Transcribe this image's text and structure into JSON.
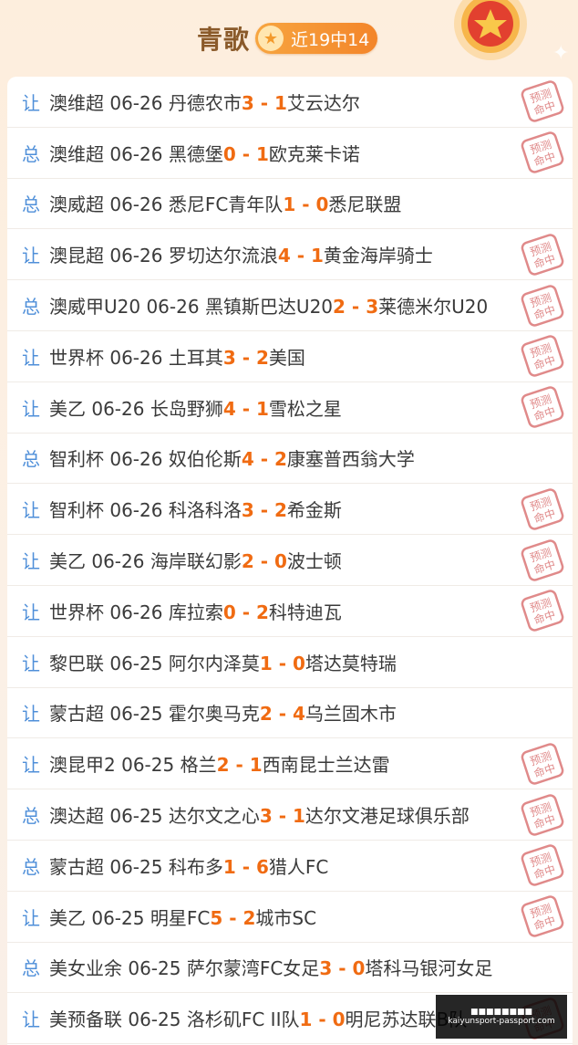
{
  "header": {
    "title": "青歌",
    "record_badge": "近19中14"
  },
  "colors": {
    "accent": "#f06b12",
    "tag_blue": "#4f8fd9",
    "badge_orange": "#f3852a",
    "stamp_red": "#e08a8a"
  },
  "stamp_text": {
    "line1": "预测",
    "line2": "命中"
  },
  "rows": [
    {
      "tag": "让",
      "league": "澳维超",
      "date": "06-26",
      "home": "丹德农市",
      "score_home": "3",
      "sep": " - ",
      "score_away": "1",
      "away": "艾云达尔",
      "hit": true
    },
    {
      "tag": "总",
      "league": "澳维超",
      "date": "06-26",
      "home": "黑德堡",
      "score_home": "0",
      "sep": " - ",
      "score_away": "1",
      "away": "欧克莱卡诺",
      "hit": true
    },
    {
      "tag": "总",
      "league": "澳威超",
      "date": "06-26",
      "home": "悉尼FC青年队",
      "score_home": "1",
      "sep": " - ",
      "score_away": "0",
      "away": "悉尼联盟",
      "hit": false
    },
    {
      "tag": "让",
      "league": "澳昆超",
      "date": "06-26",
      "home": "罗切达尔流浪",
      "score_home": "4",
      "sep": " - ",
      "score_away": "1",
      "away": "黄金海岸骑士",
      "hit": true
    },
    {
      "tag": "总",
      "league": "澳威甲U20",
      "date": "06-26",
      "home": "黑镇斯巴达U20",
      "score_home": "2",
      "sep": " - ",
      "score_away": "3",
      "away": "莱德米尔U20",
      "hit": true
    },
    {
      "tag": "让",
      "league": "世界杯",
      "date": "06-26",
      "home": "土耳其",
      "score_home": "3",
      "sep": " - ",
      "score_away": "2",
      "away": "美国",
      "hit": true
    },
    {
      "tag": "让",
      "league": "美乙",
      "date": "06-26",
      "home": "长岛野狮",
      "score_home": "4",
      "sep": " - ",
      "score_away": "1",
      "away": "雪松之星",
      "hit": true
    },
    {
      "tag": "总",
      "league": "智利杯",
      "date": "06-26",
      "home": "奴伯伦斯",
      "score_home": "4",
      "sep": " - ",
      "score_away": "2",
      "away": "康塞普西翁大学",
      "hit": false
    },
    {
      "tag": "让",
      "league": "智利杯",
      "date": "06-26",
      "home": "科洛科洛",
      "score_home": "3",
      "sep": " - ",
      "score_away": "2",
      "away": "希金斯",
      "hit": true
    },
    {
      "tag": "让",
      "league": "美乙",
      "date": "06-26",
      "home": "海岸联幻影",
      "score_home": "2",
      "sep": " - ",
      "score_away": "0",
      "away": "波士顿",
      "hit": true
    },
    {
      "tag": "让",
      "league": "世界杯",
      "date": "06-26",
      "home": "库拉索",
      "score_home": "0",
      "sep": " - ",
      "score_away": "2",
      "away": "科特迪瓦",
      "hit": true
    },
    {
      "tag": "让",
      "league": "黎巴联",
      "date": "06-25",
      "home": "阿尔内泽莫",
      "score_home": "1",
      "sep": " - ",
      "score_away": "0",
      "away": "塔达莫特瑞",
      "hit": false
    },
    {
      "tag": "让",
      "league": "蒙古超",
      "date": "06-25",
      "home": "霍尔奥马克",
      "score_home": "2",
      "sep": " - ",
      "score_away": "4",
      "away": "乌兰固木市",
      "hit": false
    },
    {
      "tag": "让",
      "league": "澳昆甲2",
      "date": "06-25",
      "home": "格兰",
      "score_home": "2",
      "sep": " - ",
      "score_away": "1",
      "away": "西南昆士兰达雷",
      "hit": true
    },
    {
      "tag": "总",
      "league": "澳达超",
      "date": "06-25",
      "home": "达尔文之心",
      "score_home": "3",
      "sep": " - ",
      "score_away": "1",
      "away": "达尔文港足球俱乐部",
      "hit": true
    },
    {
      "tag": "总",
      "league": "蒙古超",
      "date": "06-25",
      "home": "科布多",
      "score_home": "1",
      "sep": " - ",
      "score_away": "6",
      "away": "猎人FC",
      "hit": true
    },
    {
      "tag": "让",
      "league": "美乙",
      "date": "06-25",
      "home": "明星FC",
      "score_home": "5",
      "sep": " - ",
      "score_away": "2",
      "away": "城市SC",
      "hit": true
    },
    {
      "tag": "总",
      "league": "美女业余",
      "date": "06-25",
      "home": "萨尔蒙湾FC女足",
      "score_home": "3",
      "sep": " - ",
      "score_away": "0",
      "away": "塔科马银河女足",
      "hit": false
    },
    {
      "tag": "让",
      "league": "美预备联",
      "date": "06-25",
      "home": "洛杉矶FC II队",
      "score_home": "1",
      "sep": " - ",
      "score_away": "0",
      "away": "明尼苏达联B队",
      "hit": true
    }
  ],
  "watermark": {
    "line1": "■■■■■■■■",
    "line2": "kaiyunsport-passport.com"
  }
}
